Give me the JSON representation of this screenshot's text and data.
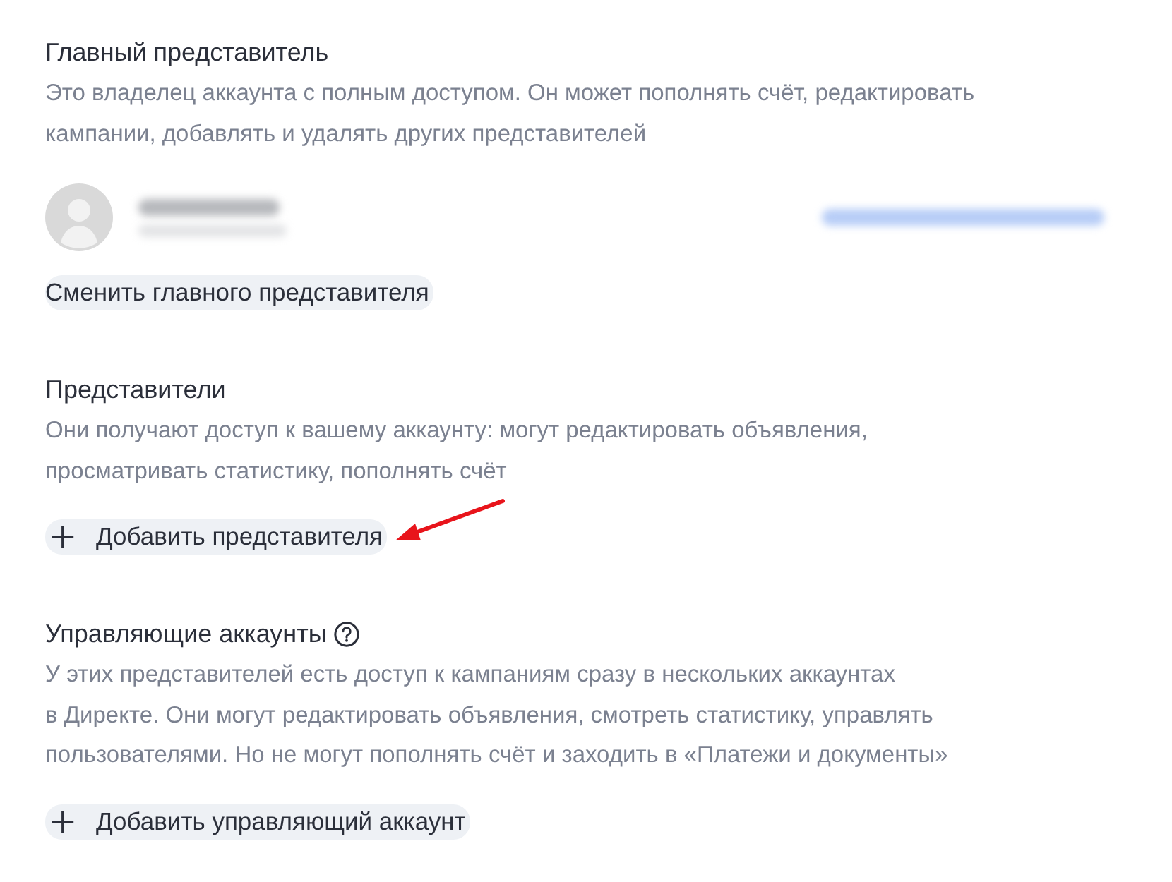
{
  "sections": [
    {
      "title": "Главный представитель",
      "help": false,
      "description": "Это владелец аккаунта с полным доступом. Он может пополнять счёт, редактировать\nкампании, добавлять и удалять других представителей",
      "owner": {
        "kind": "redacted"
      },
      "button": {
        "kind": "plain",
        "label": "Сменить главного представителя",
        "annotated": false
      }
    },
    {
      "title": "Представители",
      "help": false,
      "description": "Они получают доступ к вашему аккаунту: могут редактировать объявления,\nпросматривать статистику, пополнять счёт",
      "button": {
        "kind": "add",
        "label": "Добавить представителя",
        "annotated": true
      }
    },
    {
      "title": "Управляющие аккаунты",
      "help": true,
      "description": "У этих представителей есть доступ к кампаниям сразу в нескольких аккаунтах\nв Директе. Они могут редактировать объявления, смотреть статистику, управлять\nпользователями. Но не могут пополнять счёт и заходить в «Платежи и документы»",
      "button": {
        "kind": "add",
        "label": "Добавить управляющий аккаунт",
        "annotated": false
      }
    }
  ]
}
